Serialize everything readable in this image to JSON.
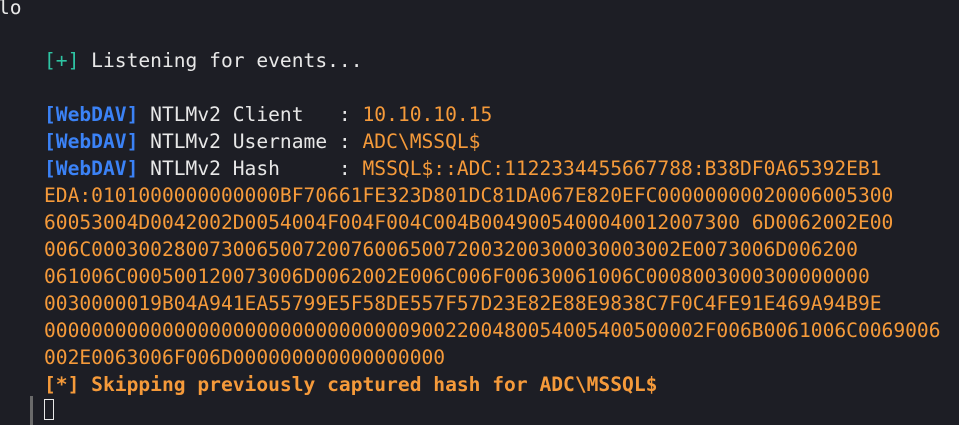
{
  "terminal": {
    "top_fragment": "lo",
    "listening": {
      "tag": "[+]",
      "text": " Listening for events..."
    },
    "client": {
      "tag": "[WebDAV]",
      "label": " NTLMv2 Client   : ",
      "value": "10.10.10.15"
    },
    "username": {
      "tag": "[WebDAV]",
      "label": " NTLMv2 Username : ",
      "value": "ADC\\MSSQL$"
    },
    "hash": {
      "tag": "[WebDAV]",
      "label": " NTLMv2 Hash     : ",
      "value": "MSSQL$::ADC:1122334455667788:B38DF0A65392EB1",
      "continuation": [
        "EDA:0101000000000000BF70661FE323D801DC81DA067E820EFC00000000020006005300",
        "60053004D0042002D0054004F004F004C004B0049005400040012007300 6D0062002E00",
        "006C00030028007300650072007600650072003200300030003002E0073006D006200",
        "061006C000500120073006D0062002E006C006F00630061006C0008003000300000000",
        "0030000019B04A941EA55799E5F58DE557F57D23E82E88E9838C7F0C4FE91E469A94B9E",
        "00000000000000000000000000000009002200480054005400500002F006B0061006C0069006",
        "002E0063006F006D000000000000000000"
      ]
    },
    "skipping": {
      "tag": "[*]",
      "text": " Skipping previously captured hash for ADC\\MSSQL$"
    },
    "colors": {
      "background": "#1d1e25",
      "green": "#2ec4a3",
      "blue": "#3b82f6",
      "orange": "#f59a3a",
      "text": "#e8e8e8"
    }
  }
}
